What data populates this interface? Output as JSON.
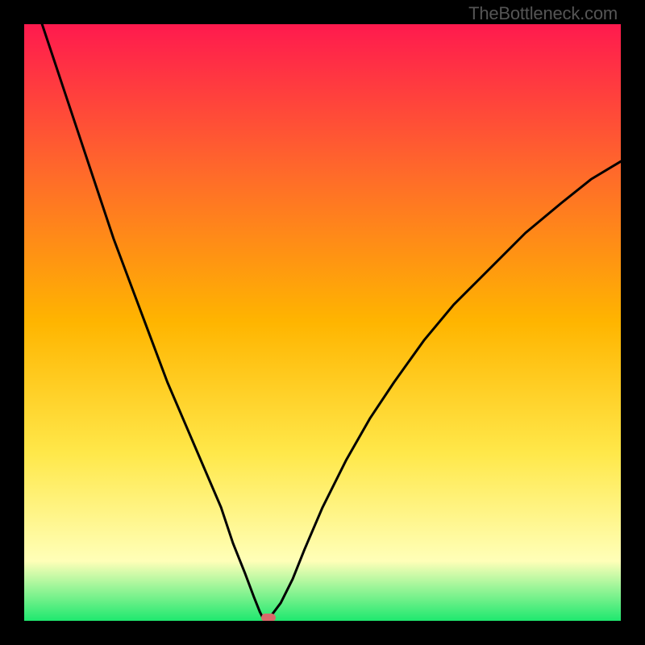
{
  "watermark": "TheBottleneck.com",
  "colors": {
    "frame": "#000000",
    "grad_top": "#ff1a4e",
    "grad_mid_upper": "#ff6a2a",
    "grad_mid": "#ffb500",
    "grad_mid_lower": "#ffe84a",
    "grad_pale": "#ffffb8",
    "grad_bottom": "#1ee86f",
    "curve": "#000000",
    "marker": "#d96a6a"
  },
  "chart_data": {
    "type": "line",
    "title": "",
    "xlabel": "",
    "ylabel": "",
    "xlim": [
      0,
      100
    ],
    "ylim": [
      0,
      100
    ],
    "grid": false,
    "series": [
      {
        "name": "bottleneck-curve",
        "x": [
          3,
          5,
          7,
          9,
          11,
          13,
          15,
          18,
          21,
          24,
          27,
          30,
          33,
          35,
          37,
          38.5,
          39.5,
          40,
          40.5,
          41.5,
          43,
          45,
          47,
          50,
          54,
          58,
          62,
          67,
          72,
          78,
          84,
          90,
          95,
          100
        ],
        "y": [
          100,
          94,
          88,
          82,
          76,
          70,
          64,
          56,
          48,
          40,
          33,
          26,
          19,
          13,
          8,
          4,
          1.5,
          0.5,
          0.5,
          1,
          3,
          7,
          12,
          19,
          27,
          34,
          40,
          47,
          53,
          59,
          65,
          70,
          74,
          77
        ]
      }
    ],
    "marker": {
      "x": 41,
      "y": 0.5
    },
    "annotations": [
      {
        "text": "TheBottleneck.com",
        "pos": "top-right"
      }
    ]
  }
}
